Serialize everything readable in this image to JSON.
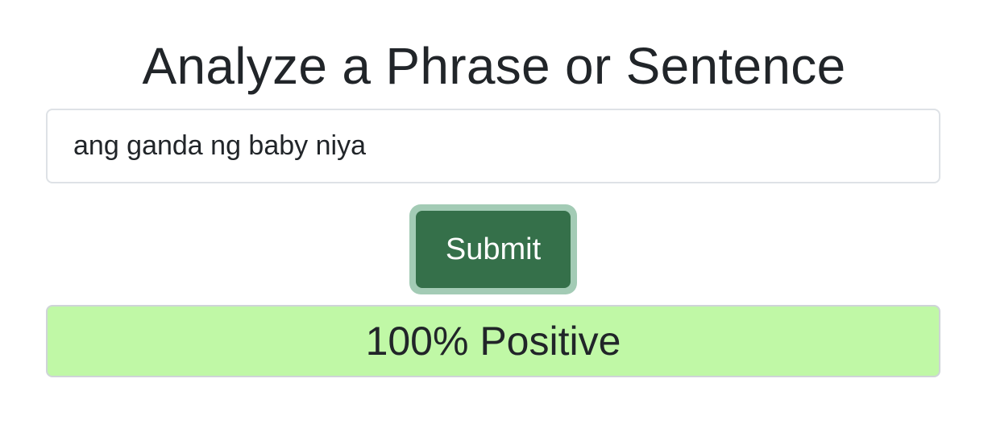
{
  "header": {
    "title": "Analyze a Phrase or Sentence"
  },
  "form": {
    "input_value": "ang ganda ng baby niya",
    "submit_label": "Submit"
  },
  "result": {
    "text": "100% Positive",
    "color": "#c0f8a6"
  },
  "colors": {
    "button": "#35704a",
    "button_focus_ring": "#a3cbb5"
  }
}
